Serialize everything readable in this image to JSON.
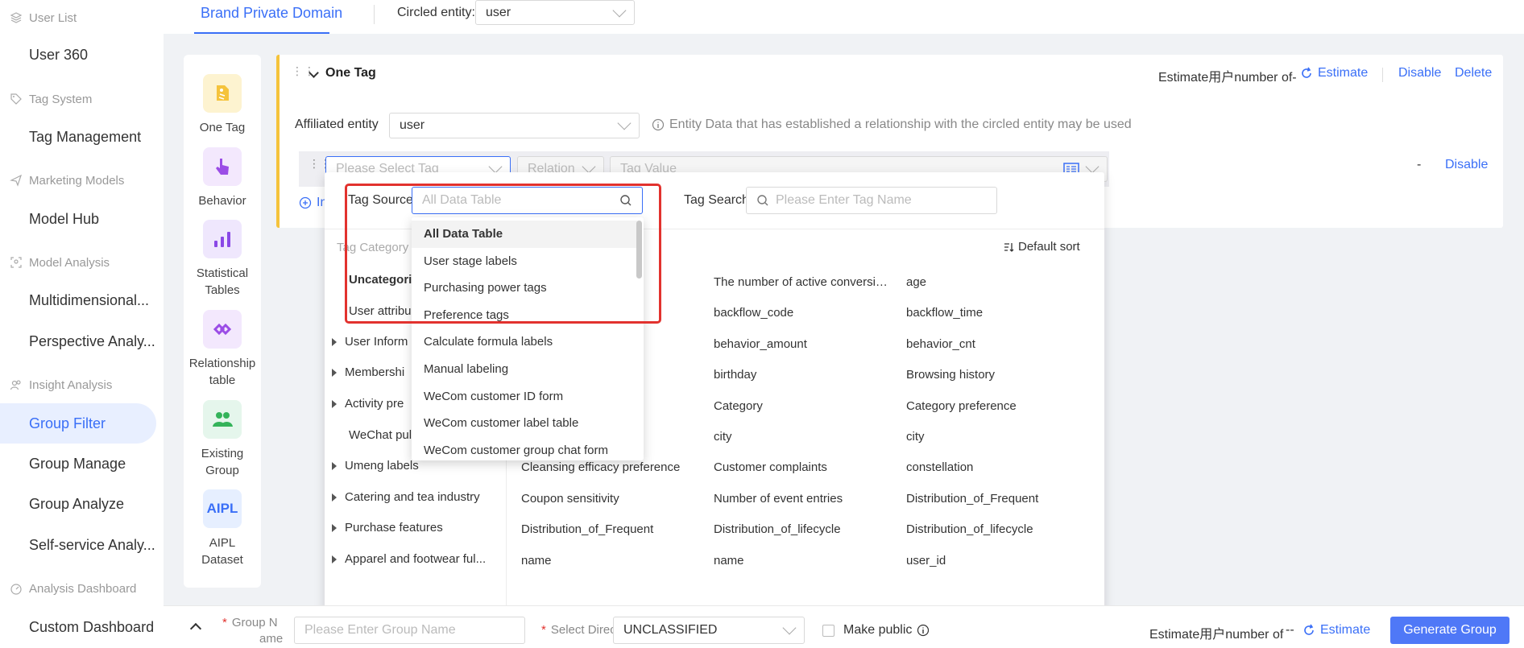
{
  "sidebar": {
    "groups": [
      {
        "label": "User List",
        "icon": "layers-icon"
      },
      {
        "label": "Tag System",
        "icon": "tag-icon"
      },
      {
        "label": "Marketing Models",
        "icon": "send-icon"
      },
      {
        "label": "Model Analysis",
        "icon": "scan-face-icon"
      },
      {
        "label": "Insight Analysis",
        "icon": "users-icon"
      },
      {
        "label": "Analysis Dashboard",
        "icon": "dashboard-icon"
      }
    ],
    "items": [
      "User 360",
      "Tag Management",
      "Model Hub",
      "Multidimensional...",
      "Perspective Analy...",
      "Group Filter",
      "Group Manage",
      "Group Analyze",
      "Self-service Analy...",
      "Custom Dashboard"
    ]
  },
  "topbar": {
    "tab": "Brand Private Domain",
    "circled_label": "Circled entity:",
    "circled_value": "user"
  },
  "components": [
    {
      "label": "One Tag",
      "icon": "tag-icon",
      "color": "#fdf3d0"
    },
    {
      "label": "Behavior",
      "icon": "pointer-icon",
      "color": "#f3e8fd"
    },
    {
      "label": "Statistical Tables",
      "icon": "bar-chart-icon",
      "color": "#efe7fd"
    },
    {
      "label": "Relationship table",
      "icon": "link-icon",
      "color": "#f3e8fd"
    },
    {
      "label": "Existing Group",
      "icon": "group-icon",
      "color": "#e5f6ec"
    },
    {
      "label": "AIPL Dataset",
      "icon": "aipl-icon",
      "color": "#e6efff",
      "text": "AIPL"
    }
  ],
  "card": {
    "title": "One Tag",
    "estimate_prefix": "Estimate用户number of-",
    "estimate_link": "Estimate",
    "disable": "Disable",
    "delete": "Delete",
    "affiliated_label": "Affiliated entity",
    "affiliated_value": "user",
    "info_text": "Entity Data that has established a relationship with the circled entity may be used",
    "tag_placeholder": "Please Select Tag",
    "relation_placeholder": "Relation",
    "value_placeholder": "Tag Value",
    "row_dash": "-",
    "row_disable": "Disable",
    "add_partial": "In"
  },
  "popup": {
    "source_label": "Tag Source:",
    "source_placeholder": "All Data Table",
    "search_label": "Tag Search:",
    "search_placeholder": "Please Enter Tag Name",
    "category_header": "Tag Category",
    "sort_label": "Default sort",
    "categories": [
      {
        "label": "Uncategori",
        "bold": true,
        "arrow": false
      },
      {
        "label": "User attribu",
        "bold": false,
        "arrow": false
      },
      {
        "label": "User Inform",
        "bold": false,
        "arrow": true
      },
      {
        "label": "Membershi",
        "bold": false,
        "arrow": true
      },
      {
        "label": "Activity pre",
        "bold": false,
        "arrow": true
      },
      {
        "label": "WeChat pul",
        "bold": false,
        "arrow": false
      },
      {
        "label": "Umeng labels",
        "bold": false,
        "arrow": true
      },
      {
        "label": "Catering and tea industry",
        "bold": false,
        "arrow": true
      },
      {
        "label": "Purchase features",
        "bold": false,
        "arrow": true
      },
      {
        "label": "Apparel and footwear ful...",
        "bold": false,
        "arrow": true
      }
    ],
    "tags": [
      [
        "",
        "The number of active conversi…",
        "age"
      ],
      [
        "",
        "backflow_code",
        "backflow_time"
      ],
      [
        "",
        "behavior_amount",
        "behavior_cnt"
      ],
      [
        "",
        "birthday",
        "Browsing history"
      ],
      [
        "",
        "Category",
        "Category preference"
      ],
      [
        "",
        "city",
        "city"
      ],
      [
        "Cleansing efficacy preference",
        "Customer complaints",
        "constellation"
      ],
      [
        "Coupon sensitivity",
        "Number of event entries",
        "Distribution_of_Frequent"
      ],
      [
        "Distribution_of_Frequent",
        "Distribution_of_lifecycle",
        "Distribution_of_lifecycle"
      ],
      [
        "name",
        "name",
        "user_id"
      ]
    ],
    "sources": [
      "All Data Table",
      "User stage labels",
      "Purchasing power tags",
      "Preference tags",
      "Calculate formula labels",
      "Manual labeling",
      "WeCom customer ID form",
      "WeCom customer label table",
      "WeCom customer group chat form"
    ]
  },
  "bottombar": {
    "group_name_label_1": "Group N",
    "group_name_label_2": "ame",
    "group_name_placeholder": "Please Enter Group Name",
    "dir_label": "Select Direc",
    "dir_value": "UNCLASSIFIED",
    "make_public": "Make public",
    "estimate_prefix": "Estimate用户number of",
    "estimate_value": "--",
    "estimate_link": "Estimate",
    "generate": "Generate Group"
  },
  "colors": {
    "accent": "#3a6ff7",
    "highlight": "#e2322e",
    "card_border": "#f5c33b"
  }
}
